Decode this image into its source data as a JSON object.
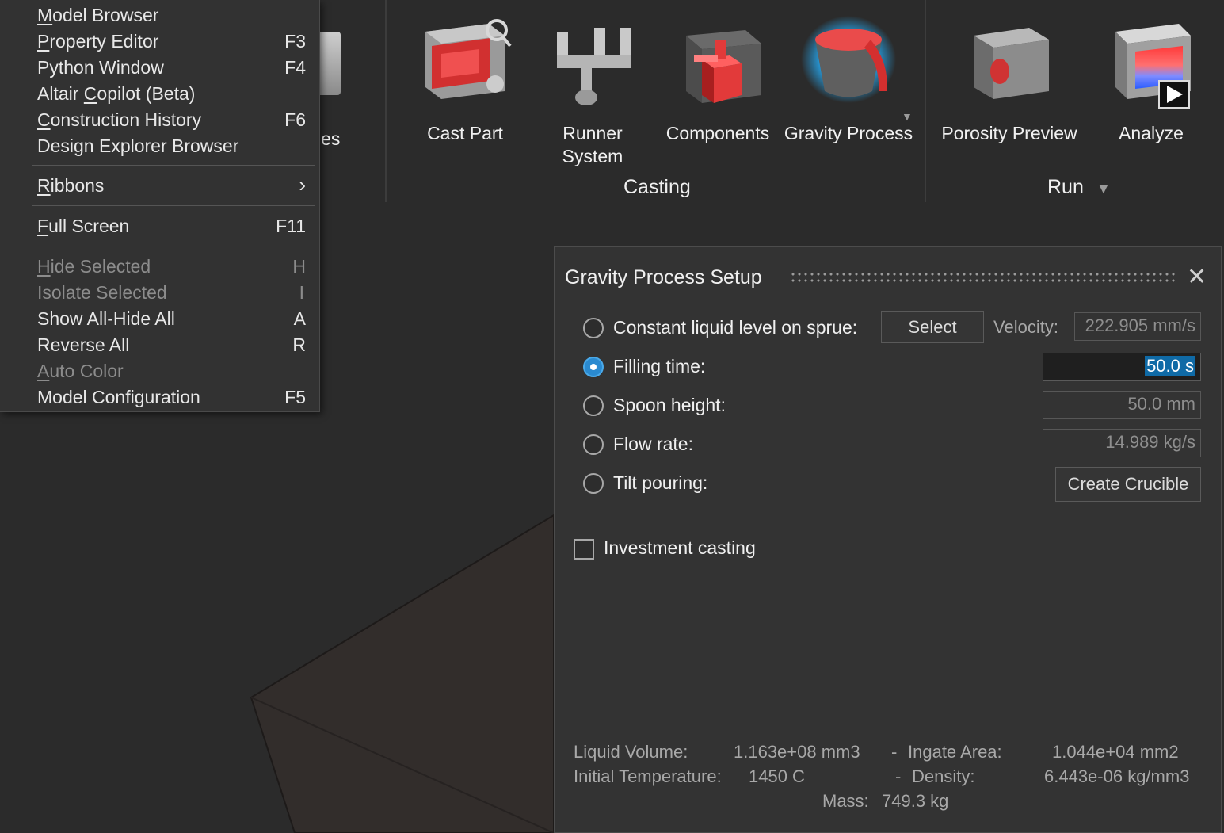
{
  "ribbon": {
    "partial_label": "les",
    "tools": [
      {
        "label": "Cast Part",
        "icon": "cast-part-icon"
      },
      {
        "label": "Runner System",
        "icon": "runner-system-icon"
      },
      {
        "label": "Components",
        "icon": "components-icon"
      },
      {
        "label": "Gravity Process",
        "icon": "gravity-process-icon"
      },
      {
        "label": "Porosity Preview",
        "icon": "porosity-preview-icon"
      },
      {
        "label": "Analyze",
        "icon": "analyze-icon"
      }
    ],
    "runner_line1": "Runner",
    "runner_line2": "System",
    "group_casting": "Casting",
    "group_run": "Run"
  },
  "menu": {
    "items": [
      {
        "pre": "",
        "ul": "M",
        "post": "odel Browser",
        "shortcut": ""
      },
      {
        "pre": "",
        "ul": "P",
        "post": "roperty Editor",
        "shortcut": "F3"
      },
      {
        "pre": "Python Window",
        "ul": "",
        "post": "",
        "shortcut": "F4"
      },
      {
        "pre": "Altair ",
        "ul": "C",
        "post": "opilot (Beta)",
        "shortcut": ""
      },
      {
        "pre": "",
        "ul": "C",
        "post": "onstruction History",
        "shortcut": "F6"
      },
      {
        "pre": "Design Explorer Browser",
        "ul": "",
        "post": "",
        "shortcut": ""
      },
      {
        "pre": "",
        "ul": "R",
        "post": "ibbons",
        "shortcut": "›"
      },
      {
        "pre": "",
        "ul": "F",
        "post": "ull Screen",
        "shortcut": "F11"
      },
      {
        "pre": "",
        "ul": "H",
        "post": "ide Selected",
        "shortcut": "H"
      },
      {
        "pre": "Isolate Selected",
        "ul": "",
        "post": "",
        "shortcut": "I"
      },
      {
        "pre": "Show All-Hide All",
        "ul": "",
        "post": "",
        "shortcut": "A"
      },
      {
        "pre": "Reverse All",
        "ul": "",
        "post": "",
        "shortcut": "R"
      },
      {
        "pre": "",
        "ul": "A",
        "post": "uto Color",
        "shortcut": ""
      },
      {
        "pre": "Model Configuration",
        "ul": "",
        "post": "",
        "shortcut": "F5"
      }
    ]
  },
  "dialog": {
    "title": "Gravity Process Setup",
    "close": "✕",
    "options": {
      "constant_level": "Constant liquid level on sprue:",
      "filling_time": "Filling time:",
      "spoon_height": "Spoon height:",
      "flow_rate": "Flow rate:",
      "tilt_pouring": "Tilt pouring:"
    },
    "selected_option": "filling_time",
    "select_button": "Select",
    "velocity_label": "Velocity:",
    "velocity_value": "222.905 mm/s",
    "filling_time_value": "50.0 s",
    "spoon_height_value": "50.0 mm",
    "flow_rate_value": "14.989 kg/s",
    "create_crucible": "Create Crucible",
    "investment_casting": "Investment casting",
    "info": {
      "liquid_volume_label": "Liquid Volume:",
      "liquid_volume_value": "1.163e+08 mm3",
      "dash1": "-",
      "ingate_area_label": "Ingate Area:",
      "ingate_area_value": "1.044e+04 mm2",
      "initial_temp_label": "Initial Temperature:",
      "initial_temp_value": "1450 C",
      "dash2": "-",
      "density_label": "Density:",
      "density_value": "6.443e-06 kg/mm3",
      "mass_label": "Mass:",
      "mass_value": "749.3 kg"
    }
  },
  "colors": {
    "accent": "#2a8ad0",
    "cast_red": "#e23a3a",
    "background": "#2b2b2b",
    "dialog": "#333333"
  }
}
